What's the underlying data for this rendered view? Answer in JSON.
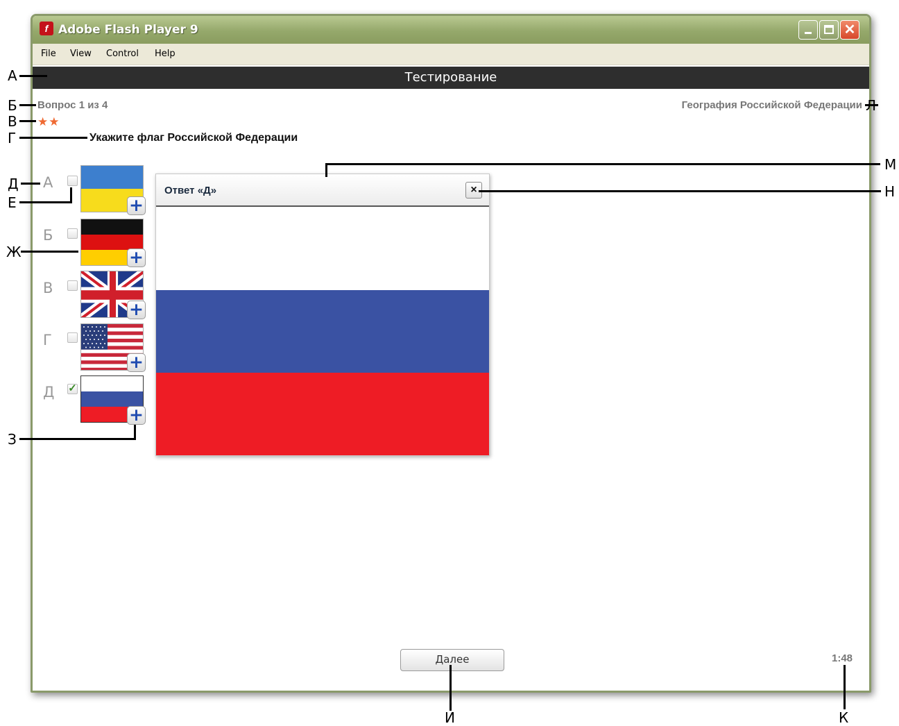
{
  "window": {
    "title": "Adobe Flash Player 9",
    "app_icon": "flash-icon",
    "buttons": [
      "minimize-icon",
      "maximize-icon",
      "close-icon"
    ]
  },
  "menu": [
    "File",
    "View",
    "Control",
    "Help"
  ],
  "header": {
    "title": "Тестирование"
  },
  "question_counter": "Вопрос 1 из 4",
  "topic": "География Российской Федерации",
  "difficulty_stars": "★★",
  "question_text": "Укажите флаг Российской Федерации",
  "options": [
    {
      "letter": "А",
      "flag": "ukraine",
      "checked": false
    },
    {
      "letter": "Б",
      "flag": "germany",
      "checked": false
    },
    {
      "letter": "В",
      "flag": "uk",
      "checked": false
    },
    {
      "letter": "Г",
      "flag": "usa",
      "checked": false
    },
    {
      "letter": "Д",
      "flag": "russia",
      "checked": true,
      "check_mark": "✓"
    }
  ],
  "zoom_glyph": "+",
  "popup": {
    "title": "Ответ «Д»",
    "close_glyph": "×",
    "flag": "russia"
  },
  "next_button": "Далее",
  "timer": "1:48",
  "callouts": {
    "A": "А",
    "B": "Б",
    "V": "В",
    "G": "Г",
    "D": "Д",
    "E": "Е",
    "ZH": "Ж",
    "Z": "З",
    "I": "И",
    "K": "К",
    "L": "Л",
    "M": "М",
    "N": "Н"
  },
  "colors": {
    "header_bg": "#2e2e2e",
    "star": "#ef6a33",
    "russia_blue": "#3a52a3",
    "russia_red": "#ee1c25"
  }
}
